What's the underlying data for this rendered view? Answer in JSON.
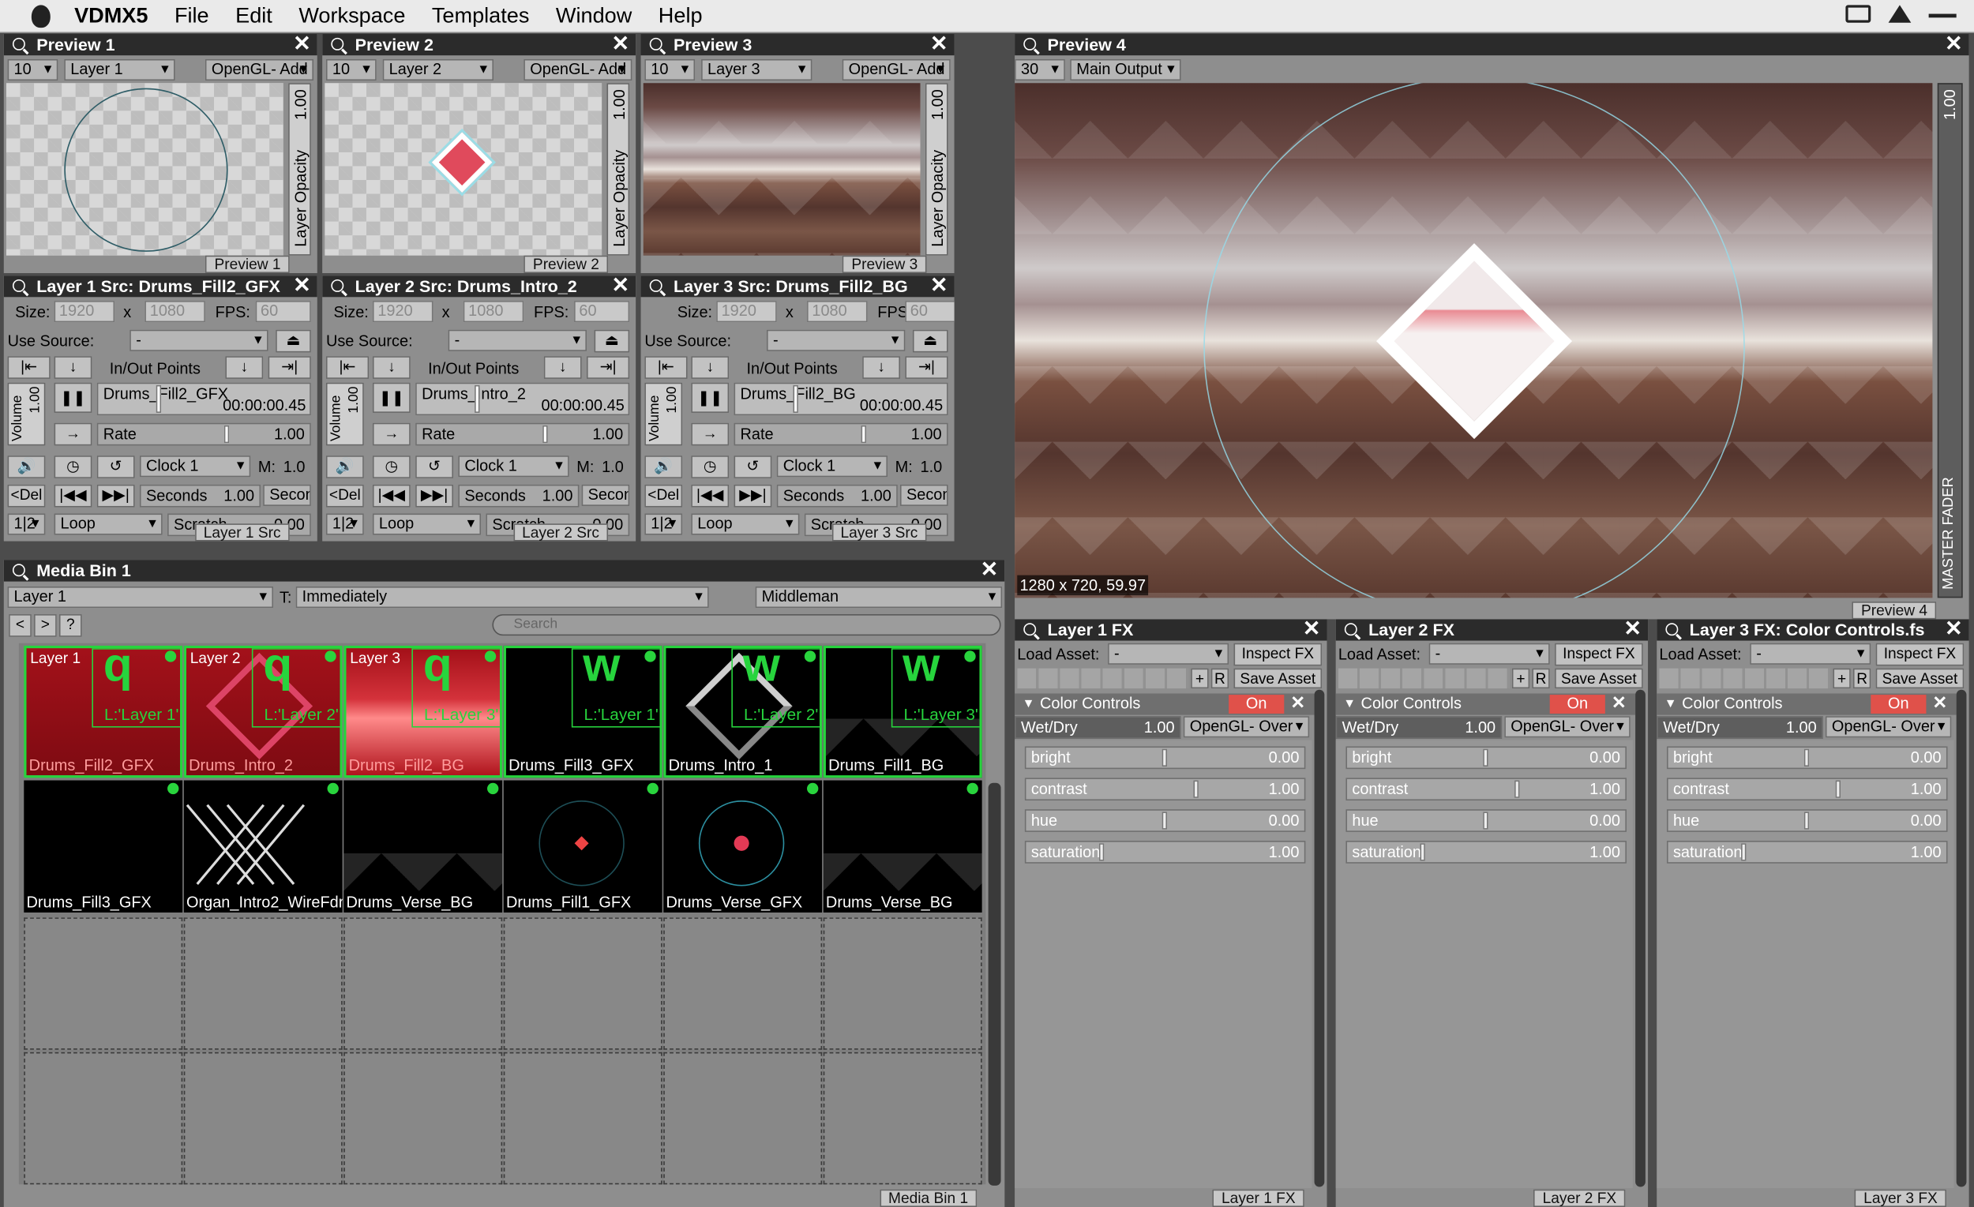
{
  "menu": {
    "app": "VDMX5",
    "items": [
      "File",
      "Edit",
      "Workspace",
      "Templates",
      "Window",
      "Help"
    ]
  },
  "previews": [
    {
      "title": "Preview 1",
      "fps": "10",
      "layer": "Layer 1",
      "blend": "OpenGL- Add",
      "opacity": "1.00",
      "opacity_label": "Layer Opacity",
      "footer": "Preview 1"
    },
    {
      "title": "Preview 2",
      "fps": "10",
      "layer": "Layer 2",
      "blend": "OpenGL- Add",
      "opacity": "1.00",
      "opacity_label": "Layer Opacity",
      "footer": "Preview 2"
    },
    {
      "title": "Preview 3",
      "fps": "10",
      "layer": "Layer 3",
      "blend": "OpenGL- Add",
      "opacity": "1.00",
      "opacity_label": "Layer Opacity",
      "footer": "Preview 3"
    }
  ],
  "preview4": {
    "title": "Preview 4",
    "fps": "30",
    "output": "Main Output",
    "resolution": "1280 x 720, 59.97",
    "fader_value": "1.00",
    "fader_label": "MASTER FADER",
    "footer": "Preview 4"
  },
  "sources": [
    {
      "title": "Layer 1 Src: Drums_Fill2_GFX",
      "size_label": "Size:",
      "w": "1920",
      "x": "x",
      "h": "1080",
      "fps_label": "FPS:",
      "fps": "60",
      "use_source_label": "Use Source:",
      "use_source": "-",
      "inout": "In/Out Points",
      "clip": "Drums_Fill2_GFX",
      "time": "00:00:00.45",
      "volume_label": "Volume",
      "volume": "1.00",
      "rate_label": "Rate",
      "rate": "1.00",
      "clock": "Clock 1",
      "m_label": "M:",
      "m": "1.0",
      "del": "<Del",
      "seconds_label": "Seconds",
      "seconds": "1.00",
      "secon": "Secon",
      "half": "1|2",
      "loop": "Loop",
      "scratch_label": "Scratch",
      "scratch": "0.00",
      "footer": "Layer 1 Src"
    },
    {
      "title": "Layer 2 Src: Drums_Intro_2",
      "size_label": "Size:",
      "w": "1920",
      "x": "x",
      "h": "1080",
      "fps_label": "FPS:",
      "fps": "60",
      "use_source_label": "Use Source:",
      "use_source": "-",
      "inout": "In/Out Points",
      "clip": "Drums_Intro_2",
      "time": "00:00:00.45",
      "volume_label": "Volume",
      "volume": "1.00",
      "rate_label": "Rate",
      "rate": "1.00",
      "clock": "Clock 1",
      "m_label": "M:",
      "m": "1.0",
      "del": "<Del",
      "seconds_label": "Seconds",
      "seconds": "1.00",
      "secon": "Secon",
      "half": "1|2",
      "loop": "Loop",
      "scratch_label": "Scratch",
      "scratch": "0.00",
      "footer": "Layer 2 Src"
    },
    {
      "title": "Layer 3 Src: Drums_Fill2_BG",
      "size_label": "Size:",
      "w": "1920",
      "x": "x",
      "h": "1080",
      "fps_label": "FPS:",
      "fps": "60",
      "use_source_label": "Use Source:",
      "use_source": "-",
      "inout": "In/Out Points",
      "clip": "Drums_Fill2_BG",
      "time": "00:00:00.45",
      "volume_label": "Volume",
      "volume": "1.00",
      "rate_label": "Rate",
      "rate": "1.00",
      "clock": "Clock 1",
      "m_label": "M:",
      "m": "1.0",
      "del": "<Del",
      "seconds_label": "Seconds",
      "seconds": "1.00",
      "secon": "Seconds",
      "half": "1|2",
      "loop": "Loop",
      "scratch_label": "Scratch",
      "scratch": "0.00",
      "footer": "Layer 3 Src"
    }
  ],
  "mediabin": {
    "title": "Media Bin 1",
    "layer": "Layer 1",
    "trigger_label": "T:",
    "trigger": "Immediately",
    "mode": "Middleman",
    "nav": [
      "<",
      ">",
      "?"
    ],
    "search_placeholder": "Search",
    "footer": "Media Bin 1",
    "clips": [
      {
        "name": "Drums_Fill2_GFX",
        "tag": "Layer 1",
        "key": "q",
        "layer": "L:'Layer 1'",
        "style": "red",
        "sel": true
      },
      {
        "name": "Drums_Intro_2",
        "tag": "Layer 2",
        "key": "q",
        "layer": "L:'Layer 2'",
        "style": "red",
        "sel": true
      },
      {
        "name": "Drums_Fill2_BG",
        "tag": "Layer 3",
        "key": "q",
        "layer": "L:'Layer 3'",
        "style": "redscene",
        "sel": true
      },
      {
        "name": "Drums_Fill3_GFX",
        "tag": "",
        "key": "w",
        "layer": "L:'Layer 1'",
        "style": "black",
        "sel": true
      },
      {
        "name": "Drums_Intro_1",
        "tag": "",
        "key": "w",
        "layer": "L:'Layer 2'",
        "style": "diamond",
        "sel": true
      },
      {
        "name": "Drums_Fill1_BG",
        "tag": "",
        "key": "w",
        "layer": "L:'Layer 3'",
        "style": "scene",
        "sel": true
      },
      {
        "name": "Drums_Fill3_GFX",
        "tag": "",
        "key": "",
        "layer": "",
        "style": "black",
        "sel": false
      },
      {
        "name": "Organ_Intro2_WireFdr",
        "tag": "",
        "key": "",
        "layer": "",
        "style": "wire",
        "sel": false
      },
      {
        "name": "Drums_Verse_BG",
        "tag": "",
        "key": "",
        "layer": "",
        "style": "scene",
        "sel": false
      },
      {
        "name": "Drums_Fill1_GFX",
        "tag": "",
        "key": "",
        "layer": "",
        "style": "dotring",
        "sel": false
      },
      {
        "name": "Drums_Verse_GFX",
        "tag": "",
        "key": "",
        "layer": "",
        "style": "ring",
        "sel": false
      },
      {
        "name": "Drums_Verse_BG",
        "tag": "",
        "key": "",
        "layer": "",
        "style": "scene",
        "sel": false
      }
    ]
  },
  "fx": [
    {
      "title": "Layer 1 FX",
      "load_label": "Load Asset:",
      "load": "-",
      "inspect": "Inspect FX",
      "plus": "+",
      "r": "R",
      "save": "Save Asset",
      "effect": "Color Controls",
      "on": "On",
      "wetdry_label": "Wet/Dry",
      "wetdry": "1.00",
      "blend": "OpenGL- Over",
      "params": [
        {
          "name": "bright",
          "value": "0.00",
          "pos": 0.5
        },
        {
          "name": "contrast",
          "value": "1.00",
          "pos": 0.62
        },
        {
          "name": "hue",
          "value": "0.00",
          "pos": 0.5
        },
        {
          "name": "saturation",
          "value": "1.00",
          "pos": 0.27
        }
      ],
      "footer": "Layer 1 FX"
    },
    {
      "title": "Layer 2 FX",
      "load_label": "Load Asset:",
      "load": "-",
      "inspect": "Inspect FX",
      "plus": "+",
      "r": "R",
      "save": "Save Asset",
      "effect": "Color Controls",
      "on": "On",
      "wetdry_label": "Wet/Dry",
      "wetdry": "1.00",
      "blend": "OpenGL- Over",
      "params": [
        {
          "name": "bright",
          "value": "0.00",
          "pos": 0.5
        },
        {
          "name": "contrast",
          "value": "1.00",
          "pos": 0.62
        },
        {
          "name": "hue",
          "value": "0.00",
          "pos": 0.5
        },
        {
          "name": "saturation",
          "value": "1.00",
          "pos": 0.27
        }
      ],
      "footer": "Layer 2 FX"
    },
    {
      "title": "Layer 3 FX: Color Controls.fs",
      "load_label": "Load Asset:",
      "load": "-",
      "inspect": "Inspect FX",
      "plus": "+",
      "r": "R",
      "save": "Save Asset",
      "effect": "Color Controls",
      "on": "On",
      "wetdry_label": "Wet/Dry",
      "wetdry": "1.00",
      "blend": "OpenGL- Over",
      "params": [
        {
          "name": "bright",
          "value": "0.00",
          "pos": 0.5
        },
        {
          "name": "contrast",
          "value": "1.00",
          "pos": 0.62
        },
        {
          "name": "hue",
          "value": "0.00",
          "pos": 0.5
        },
        {
          "name": "saturation",
          "value": "1.00",
          "pos": 0.27
        }
      ],
      "footer": "Layer 3 FX"
    }
  ],
  "colors": {
    "accent_green": "#27d43d",
    "on_red": "#e0514a",
    "title_bar": "#2b2b2b"
  },
  "icons": [
    "apple-icon",
    "magnifier-icon",
    "close-icon",
    "play-icon",
    "pause-icon",
    "speaker-icon",
    "loop-icon"
  ]
}
